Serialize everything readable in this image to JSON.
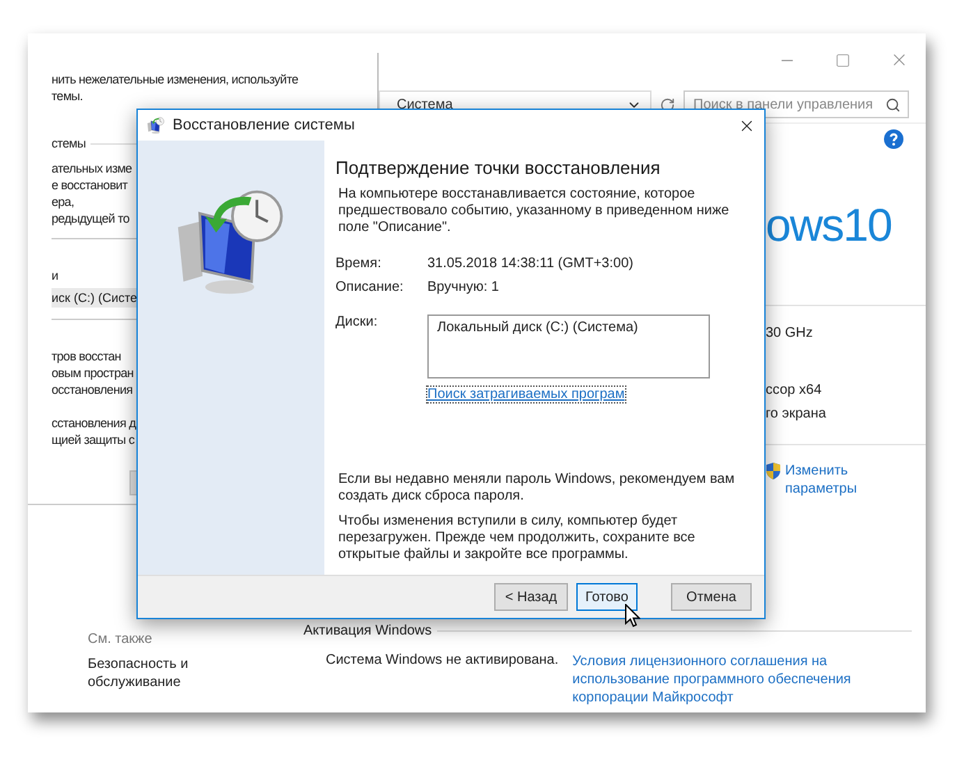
{
  "system_window": {
    "address": "Система",
    "search": {
      "placeholder": "Поиск в панели управления"
    },
    "logo": "ows10",
    "specs": [
      "30 GHz",
      "ссор x64",
      "го экрана"
    ],
    "change_settings": "Изменить параметры",
    "see_also": {
      "heading": "См. также",
      "links": [
        "Безопасность и обслуживание"
      ]
    },
    "activation": {
      "heading": "Активация Windows",
      "status": "Система Windows не активирована.",
      "link": "Условия лицензионного соглашения на использование программного обеспечения корпорации Майкрософт"
    }
  },
  "system_protection_window": {
    "sections": [
      {
        "lines": [
          "нить нежелательные изменения, используйте",
          "темы."
        ]
      },
      {
        "group": "стемы",
        "lines": [
          "ательных изме",
          "е восстановит",
          "ера,",
          "редыдущей то"
        ],
        "divider_after": true
      },
      {
        "lines": [
          "и"
        ],
        "rows": [
          "иск (C:) (Систе"
        ],
        "divider_after": true
      },
      {
        "lines": [
          "тров восстан",
          "овым простран",
          "осстановления"
        ]
      },
      {
        "lines": [
          "сстановления д",
          "щией защиты с"
        ]
      }
    ]
  },
  "dialog": {
    "title": "Восстановление системы",
    "heading": "Подтверждение точки восстановления",
    "intro": "На компьютере восстанавливается состояние, которое предшествовало событию, указанному в приведенном ниже поле \"Описание\".",
    "details": [
      {
        "label": "Время:",
        "value": "31.05.2018 14:38:11 (GMT+3:00)"
      },
      {
        "label": "Описание:",
        "value": "Вручную: 1"
      }
    ],
    "disks": {
      "label": "Диски:",
      "items": [
        "Локальный диск (C:) (Система)"
      ]
    },
    "link": "Поиск затрагиваемых програм",
    "notes": [
      "Если вы недавно меняли пароль Windows, рекомендуем вам создать диск сброса пароля.",
      "Чтобы изменения вступили в силу, компьютер будет перезагружен. Прежде чем продолжить, сохраните все открытые файлы и закройте все программы."
    ],
    "buttons": [
      {
        "label": "< Назад",
        "focused": false
      },
      {
        "label": "Готово",
        "focused": true
      },
      {
        "label": "Отмена",
        "focused": false
      }
    ]
  }
}
